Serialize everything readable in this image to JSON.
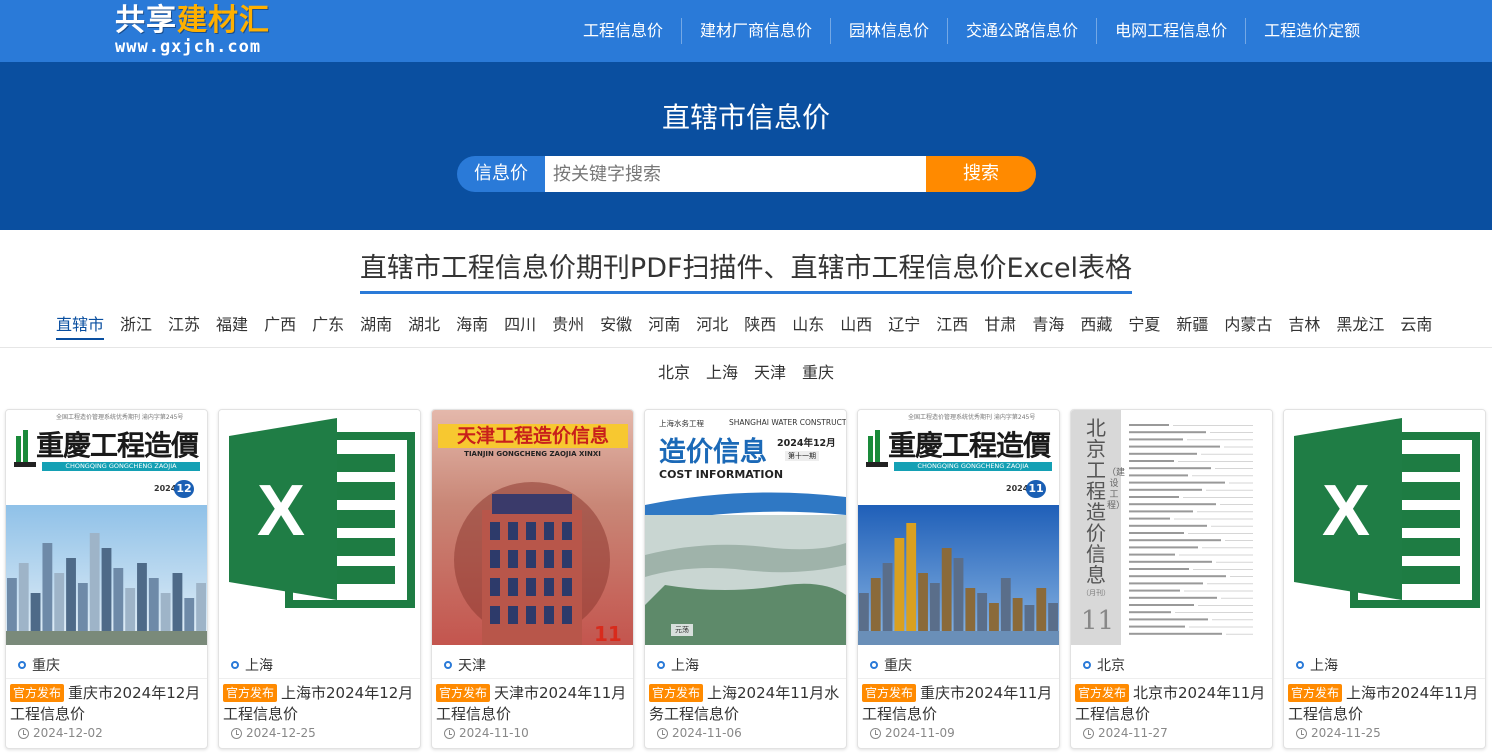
{
  "brand": {
    "name_part1": "共享",
    "name_part2": "建材汇",
    "url": "www.gxjch.com",
    "accent_color": "#ffb000"
  },
  "nav": {
    "items": [
      {
        "label": "工程信息价"
      },
      {
        "label": "建材厂商信息价"
      },
      {
        "label": "园林信息价"
      },
      {
        "label": "交通公路信息价"
      },
      {
        "label": "电网工程信息价"
      },
      {
        "label": "工程造价定额"
      }
    ],
    "bg_color": "#2a7ad8"
  },
  "hero": {
    "title": "直辖市信息价",
    "bg_color": "#0a4fa0",
    "search": {
      "category_label": "信息价",
      "placeholder": "按关键字搜索",
      "value": "",
      "button_label": "搜索",
      "button_color": "#ff8a00"
    }
  },
  "section": {
    "title": "直辖市工程信息价期刊PDF扫描件、直辖市工程信息价Excel表格"
  },
  "regions": {
    "active": "直辖市",
    "items": [
      "直辖市",
      "浙江",
      "江苏",
      "福建",
      "广西",
      "广东",
      "湖南",
      "湖北",
      "海南",
      "四川",
      "贵州",
      "安徽",
      "河南",
      "河北",
      "陕西",
      "山东",
      "山西",
      "辽宁",
      "江西",
      "甘肃",
      "青海",
      "西藏",
      "宁夏",
      "新疆",
      "内蒙古",
      "吉林",
      "黑龙江",
      "云南"
    ],
    "sub_items": [
      "北京",
      "上海",
      "天津",
      "重庆"
    ]
  },
  "cards": [
    {
      "cover_type": "chongqing-magazine",
      "cover": {
        "small": "全国工程造价管理系统优秀期刊",
        "small2": "渝内字第245号",
        "name": "重慶工程造價",
        "pinyin": "CHONGQING GONGCHENG ZAOJIA",
        "year": "2024",
        "year_sub": "总第 期",
        "issue": "12"
      },
      "region": "重庆",
      "badge": "官方发布",
      "title": "重庆市2024年12月工程信息价",
      "date": "2024-12-02"
    },
    {
      "cover_type": "excel",
      "cover": {
        "letter": "X"
      },
      "region": "上海",
      "badge": "官方发布",
      "title": "上海市2024年12月工程信息价",
      "date": "2024-12-25"
    },
    {
      "cover_type": "tianjin-magazine",
      "cover": {
        "name": "天津工程造价信息",
        "pinyin": "TIANJIN GONGCHENG ZAOJIA XINXI",
        "issue": "11"
      },
      "region": "天津",
      "badge": "官方发布",
      "title": "天津市2024年11月工程信息价",
      "date": "2024-11-10"
    },
    {
      "cover_type": "shanghai-water",
      "cover": {
        "small": "上海水务工程",
        "small_en": "SHANGHAI WATER CONSTRUCTION",
        "name": "造价信息",
        "date": "2024年12月",
        "issue_no": "第十一期",
        "en": "COST INFORMATION",
        "tag": "元荡"
      },
      "region": "上海",
      "badge": "官方发布",
      "title": "上海2024年11月水务工程信息价",
      "date": "2024-11-06"
    },
    {
      "cover_type": "chongqing-magazine",
      "cover": {
        "small": "全国工程造价管理系统优秀期刊",
        "small2": "渝内字第245号",
        "name": "重慶工程造價",
        "pinyin": "CHONGQING GONGCHENG ZAOJIA",
        "year": "2024",
        "year_sub": "总第 期",
        "issue": "11"
      },
      "region": "重庆",
      "badge": "官方发布",
      "title": "重庆市2024年11月工程信息价",
      "date": "2024-11-09"
    },
    {
      "cover_type": "beijing-magazine",
      "cover": {
        "name": "北京工程造价信息",
        "side": "（建设工程）",
        "month": "（月刊）",
        "issue": "11"
      },
      "region": "北京",
      "badge": "官方发布",
      "title": "北京市2024年11月工程信息价",
      "date": "2024-11-27"
    },
    {
      "cover_type": "excel",
      "cover": {
        "letter": "X"
      },
      "region": "上海",
      "badge": "官方发布",
      "title": "上海市2024年11月工程信息价",
      "date": "2024-11-25"
    }
  ]
}
